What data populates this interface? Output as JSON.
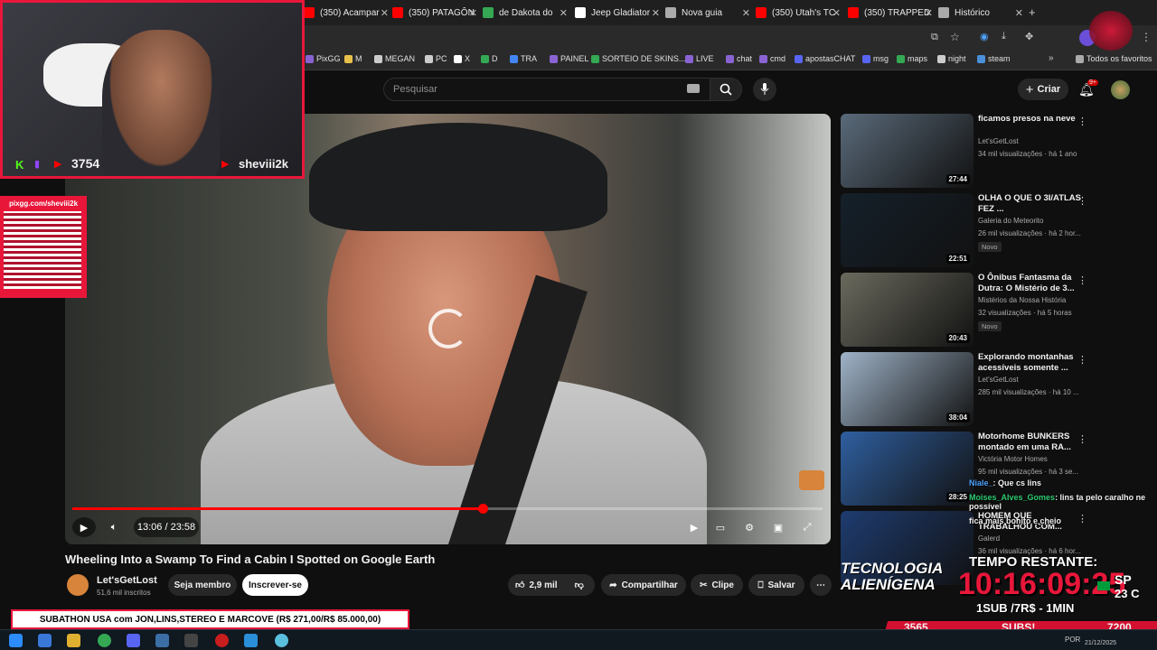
{
  "tabs": [
    {
      "label": "(350) Acampar",
      "color": "#ff0000"
    },
    {
      "label": "(350) PATAGÔN",
      "color": "#ff0000"
    },
    {
      "label": "de Dakota do",
      "color": "#34a853"
    },
    {
      "label": "Jeep Gladiator",
      "color": "#ffffff"
    },
    {
      "label": "Nova guia",
      "color": "#aaaaaa"
    },
    {
      "label": "(350) Utah's TC",
      "color": "#ff0000"
    },
    {
      "label": "(350) TRAPPED",
      "color": "#ff0000"
    },
    {
      "label": "Histórico",
      "color": "#aaaaaa"
    }
  ],
  "bookmarks": [
    {
      "label": "PixGG",
      "color": "#8a63d2"
    },
    {
      "label": "M",
      "color": "#e7c14a"
    },
    {
      "label": "MEGAN",
      "color": "#cccccc"
    },
    {
      "label": "PC",
      "color": "#cccccc"
    },
    {
      "label": "X",
      "color": "#ffffff"
    },
    {
      "label": "D",
      "color": "#34a853"
    },
    {
      "label": "TRA",
      "color": "#4285f4"
    },
    {
      "label": "PAINEL",
      "color": "#8a63d2"
    },
    {
      "label": "SORTEIO DE SKINS...",
      "color": "#34a853"
    },
    {
      "label": "LIVE",
      "color": "#8a63d2"
    },
    {
      "label": "chat",
      "color": "#8a63d2"
    },
    {
      "label": "cmd",
      "color": "#8a63d2"
    },
    {
      "label": "apostasCHAT",
      "color": "#5865f2"
    },
    {
      "label": "msg",
      "color": "#5865f2"
    },
    {
      "label": "maps",
      "color": "#34a853"
    },
    {
      "label": "night",
      "color": "#cccccc"
    },
    {
      "label": "steam",
      "color": "#4a90d9"
    }
  ],
  "bookmarks_all": "Todos os favoritos",
  "search_placeholder": "Pesquisar",
  "create_label": "Criar",
  "notif_badge": "9+",
  "video": {
    "time": "13:06 / 23:58",
    "progress_fraction": 0.547,
    "title": "Wheeling Into a Swamp To Find a Cabin I Spotted on Google Earth",
    "channel": "Let'sGetLost",
    "subs": "51,6 mil inscritos",
    "member_label": "Seja membro",
    "subscribe_label": "Inscrever-se",
    "likes": "2,9 mil",
    "share_label": "Compartilhar",
    "clip_label": "Clipe",
    "save_label": "Salvar"
  },
  "suggestions": [
    {
      "title": "ficamos presos na neve",
      "channel": "Let'sGetLost",
      "meta": "34 mil visualizações · há 1 ano",
      "duration": "27:44",
      "badge": "",
      "thumb": "#5a6a7a"
    },
    {
      "title": "OLHA O QUE O 3I/ATLAS FEZ ...",
      "channel": "Galeria do Meteorito",
      "meta": "26 mil visualizações · há 2 hor...",
      "duration": "22:51",
      "badge": "Novo",
      "thumb": "#15202a"
    },
    {
      "title": "O Ônibus Fantasma da Dutra: O Mistério de 3...",
      "channel": "Mistérios da Nossa História",
      "meta": "32 visualizações · há 5 horas",
      "duration": "20:43",
      "badge": "Novo",
      "thumb": "#6b6a5e"
    },
    {
      "title": "Explorando montanhas acessíveis somente ...",
      "channel": "Let'sGetLost",
      "meta": "285 mil visualizações · há 10 ...",
      "duration": "38:04",
      "badge": "",
      "thumb": "#9fb3c8"
    },
    {
      "title": "Motorhome BUNKERS montado em uma RA...",
      "channel": "Victória Motor Homes",
      "meta": "95 mil visualizações · há 3 se...",
      "duration": "28:25",
      "badge": "",
      "thumb": "#2f5fa0"
    },
    {
      "title": "HOMEM QUE TRABALHOU COM...",
      "channel": "Galerd",
      "meta": "36 mil visualizações · há 6 hor...",
      "duration": "",
      "badge": "",
      "thumb": "#1e3c70"
    }
  ],
  "stream": {
    "cam_count": "3754",
    "cam_name": "sheviii2k",
    "pix_label": "pixgg.com/sheviii2k",
    "subathon": "SUBATHON USA com JON,LINS,STEREO E MARCOVE (R$ 271,00/R$ 85.000,00)",
    "tech_line1": "TECNOLOGIA",
    "tech_line2": "ALIENÍGENA",
    "tempo_label": "TEMPO RESTANTE:",
    "timer": "10:16:09:25",
    "rate": "1SUB /7R$ - 1MIN",
    "weather_city": "SP",
    "weather_temp": "23 C",
    "bar_left": "3565",
    "bar_mid": "SUBS!",
    "bar_right": "7200",
    "chat": [
      {
        "user": "Niale_",
        "msg": ": Que cs lins",
        "color": "#4fa3ff"
      },
      {
        "user": "Moises_Alves_Gomes",
        "msg": ": lins ta pelo caralho ne possível",
        "color": "#2ecc71"
      },
      {
        "user": "",
        "msg": "fica mais bonito e cheio",
        "color": "#ffffff"
      }
    ]
  },
  "taskbar": {
    "lang": "POR",
    "date": "21/12/2025"
  }
}
